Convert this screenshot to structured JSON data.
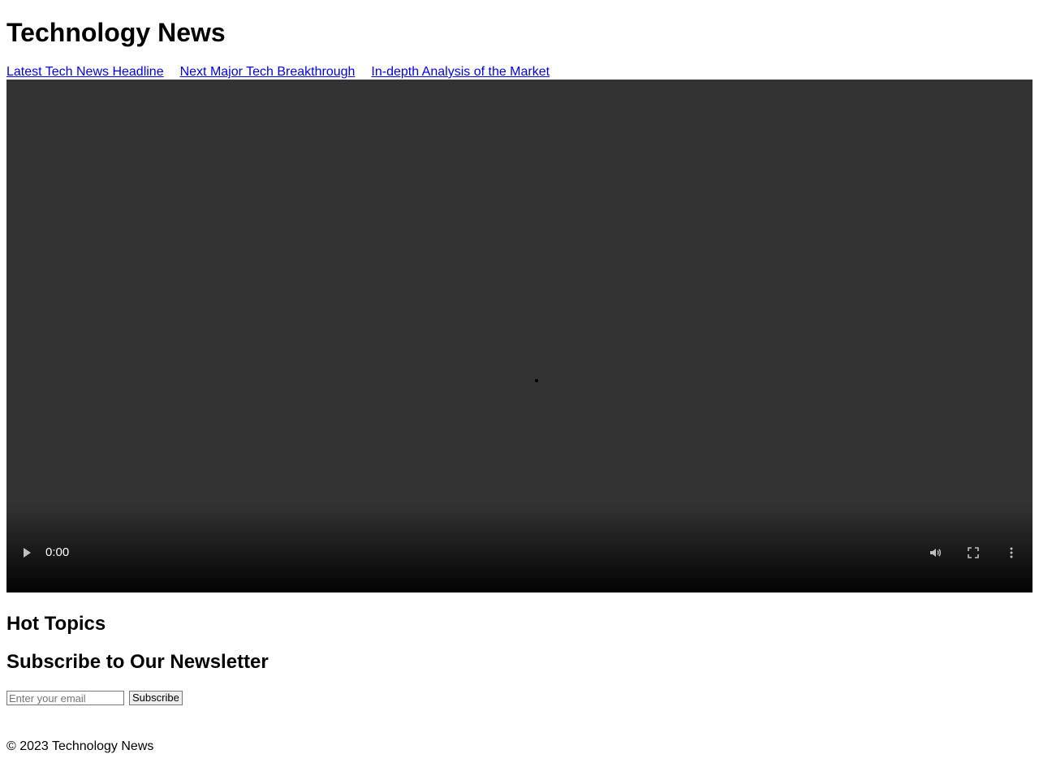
{
  "header": {
    "title": "Technology News"
  },
  "nav": {
    "links": [
      {
        "label": "Latest Tech News Headline"
      },
      {
        "label": "Next Major Tech Breakthrough"
      },
      {
        "label": "In-depth Analysis of the Market"
      }
    ]
  },
  "video": {
    "current_time": "0:00",
    "icons": {
      "play": "play-icon",
      "volume": "volume-icon",
      "fullscreen": "fullscreen-icon",
      "more": "more-options-icon"
    },
    "background_color": "#333333"
  },
  "sections": {
    "hot_topics_title": "Hot Topics",
    "newsletter_title": "Subscribe to Our Newsletter"
  },
  "newsletter": {
    "email_placeholder": "Enter your email",
    "email_value": "",
    "subscribe_label": "Subscribe"
  },
  "footer": {
    "text": "© 2023 Technology News"
  },
  "colors": {
    "link": "#0000ee"
  }
}
